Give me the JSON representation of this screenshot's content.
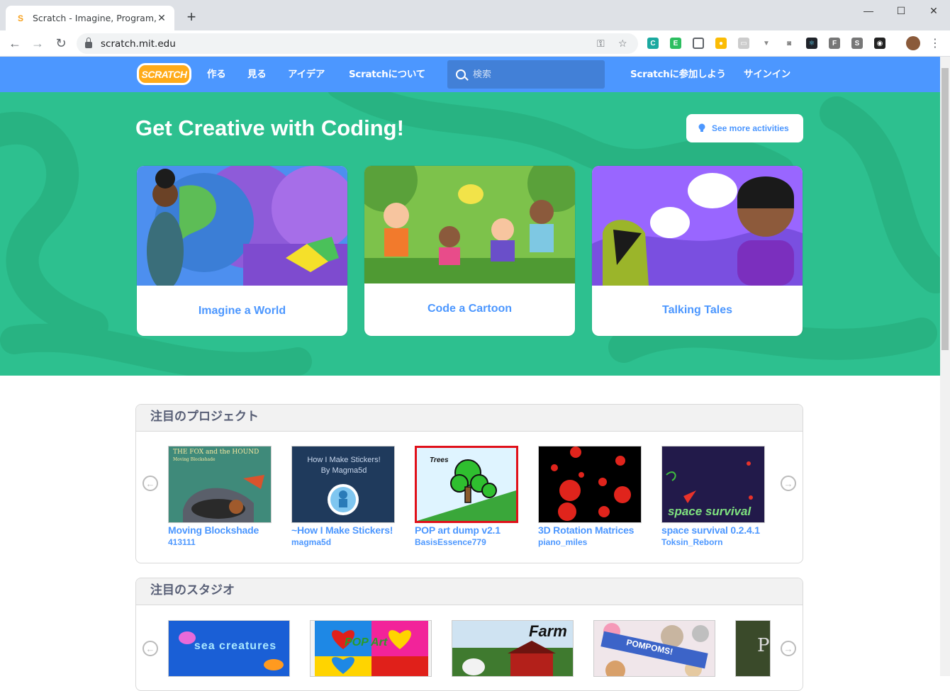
{
  "browser": {
    "tab_title": "Scratch - Imagine, Program, Share",
    "url": "scratch.mit.edu",
    "new_tab": "+",
    "close": "✕"
  },
  "nav": {
    "logo": "SCRATCH",
    "links": [
      "作る",
      "見る",
      "アイデア",
      "Scratchについて"
    ],
    "search_placeholder": "検索",
    "join": "Scratchに参加しよう",
    "signin": "サインイン",
    "accent": "#4c97ff"
  },
  "hero": {
    "title": "Get Creative with Coding!",
    "more_button": "See more activities",
    "background": "#2dc08f",
    "cards": [
      {
        "label": "Imagine a World"
      },
      {
        "label": "Code a Cartoon"
      },
      {
        "label": "Talking Tales"
      }
    ]
  },
  "featured_projects": {
    "heading": "注目のプロジェクト",
    "items": [
      {
        "title": "Moving Blockshade",
        "author": "413111",
        "thumb_text": "THE FOX and the HOUND",
        "thumb_sub": "Moving Blockshade"
      },
      {
        "title": "~How I Make Stickers!",
        "author": "magma5d",
        "thumb_text": "How I Make Stickers!",
        "thumb_sub": "By Magma5d"
      },
      {
        "title": "POP art dump v2.1",
        "author": "BasisEssence779",
        "thumb_text": "Trees"
      },
      {
        "title": "3D Rotation Matrices",
        "author": "piano_miles"
      },
      {
        "title": "space survival 0.2.4.1",
        "author": "Toksin_Reborn",
        "thumb_text": "space survival"
      }
    ]
  },
  "featured_studios": {
    "heading": "注目のスタジオ",
    "items": [
      {
        "thumb_text": "sea creatures"
      },
      {
        "thumb_text": "POP Art"
      },
      {
        "thumb_text": "Farm"
      },
      {
        "thumb_text": "POMPOMS!"
      },
      {
        "thumb_text": "P"
      }
    ]
  }
}
